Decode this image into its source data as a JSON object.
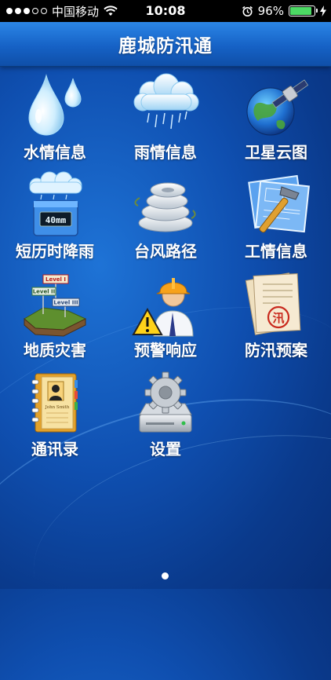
{
  "status_bar": {
    "carrier": "中国移动",
    "time": "10:08",
    "battery_percent": "96%",
    "battery_level": 0.96,
    "signal_dots_filled": 3,
    "signal_dots_total": 5,
    "icons": [
      "wifi-icon",
      "alarm-icon",
      "charging-bolt-icon"
    ]
  },
  "header": {
    "title": "鹿城防汛通"
  },
  "menu": {
    "items": [
      {
        "label": "水情信息",
        "icon": "water-drops-icon"
      },
      {
        "label": "雨情信息",
        "icon": "rain-cloud-icon"
      },
      {
        "label": "卫星云图",
        "icon": "satellite-globe-icon"
      },
      {
        "label": "短历时降雨",
        "icon": "rain-gauge-icon",
        "gauge_text": "40mm"
      },
      {
        "label": "台风路径",
        "icon": "typhoon-icon"
      },
      {
        "label": "工情信息",
        "icon": "blueprint-hammer-icon"
      },
      {
        "label": "地质灾害",
        "icon": "geology-level-signs-icon",
        "signs": [
          "Level I",
          "Level II",
          "Level III"
        ]
      },
      {
        "label": "预警响应",
        "icon": "warning-worker-icon"
      },
      {
        "label": "防汛预案",
        "icon": "plan-documents-icon",
        "seal_text": "汛"
      },
      {
        "label": "通讯录",
        "icon": "address-book-icon",
        "card_text": "John Smith"
      },
      {
        "label": "设置",
        "icon": "settings-gear-icon"
      }
    ]
  },
  "pager": {
    "current_page": 1,
    "total_pages": 1
  },
  "colors": {
    "background": "#0f4fb0",
    "navbar": "#1662c6",
    "battery": "#4cd964"
  }
}
